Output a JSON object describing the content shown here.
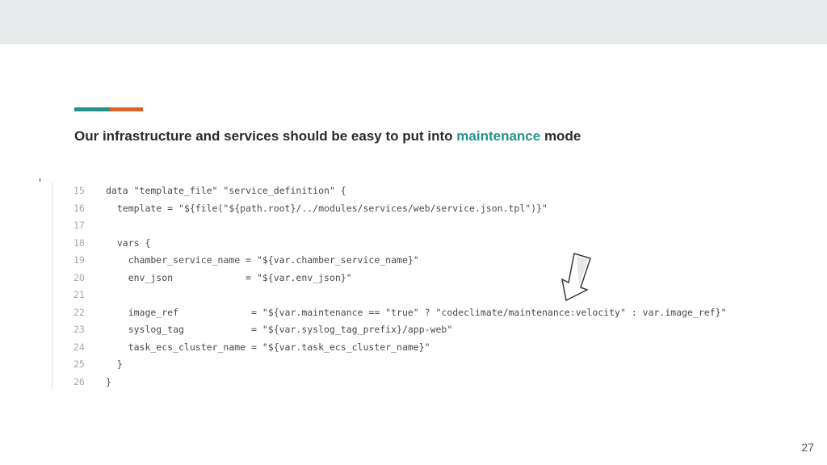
{
  "slide": {
    "title_part1": "Our infrastructure and services should be easy to put into ",
    "title_highlight": "maintenance",
    "title_part2": " mode",
    "page_number": "27"
  },
  "code": {
    "lines": [
      {
        "num": "15",
        "text": "data \"template_file\" \"service_definition\" {"
      },
      {
        "num": "16",
        "text": "  template = \"${file(\"${path.root}/../modules/services/web/service.json.tpl\")}\""
      },
      {
        "num": "17",
        "text": ""
      },
      {
        "num": "18",
        "text": "  vars {"
      },
      {
        "num": "19",
        "text": "    chamber_service_name = \"${var.chamber_service_name}\""
      },
      {
        "num": "20",
        "text": "    env_json             = \"${var.env_json}\""
      },
      {
        "num": "21",
        "text": ""
      },
      {
        "num": "22",
        "text": "    image_ref             = \"${var.maintenance == \"true\" ? \"codeclimate/maintenance:velocity\" : var.image_ref}\""
      },
      {
        "num": "23",
        "text": "    syslog_tag            = \"${var.syslog_tag_prefix}/app-web\""
      },
      {
        "num": "24",
        "text": "    task_ecs_cluster_name = \"${var.task_ecs_cluster_name}\""
      },
      {
        "num": "25",
        "text": "  }"
      },
      {
        "num": "26",
        "text": "}"
      }
    ]
  },
  "colors": {
    "accent_teal": "#26928d",
    "accent_orange": "#e0612a",
    "topbar": "#e7eaea"
  },
  "icons": {
    "annotation": "down-arrow-icon"
  }
}
